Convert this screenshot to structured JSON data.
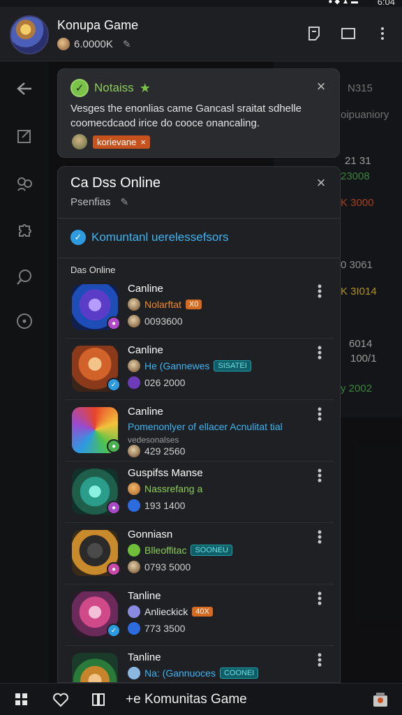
{
  "status": {
    "time": "6:04"
  },
  "header": {
    "title": "Konupa Game",
    "coins": "6.0000K",
    "icons": [
      "note-icon",
      "window-icon",
      "more-icon"
    ]
  },
  "notification": {
    "title": "Notaiss",
    "body": "Vesges the enonlias came Gancasl sraitat sdhelle coomecdcaod irice do cooce onancaling.",
    "chip": "korievаne"
  },
  "background_panel": {
    "lines": [
      {
        "text": "N315",
        "color": "#9a9a9a"
      },
      {
        "text": "oipuaniory",
        "color": "#9a9a9a"
      },
      {
        "text": "21 31",
        "color": "#cfcfcf"
      },
      {
        "text": "23008",
        "color": "#4caf50"
      },
      {
        "text": "K 3000",
        "color": "#e0552a"
      },
      {
        "text": "0 3061",
        "color": "#bdbdbd"
      },
      {
        "text": "K 3I014",
        "color": "#e8c02a"
      },
      {
        "text": "6014",
        "color": "#cfcfcf"
      },
      {
        "text": "100/1",
        "color": "#cfcfcf"
      },
      {
        "text": "y 2002",
        "color": "#4caf50"
      }
    ]
  },
  "modal": {
    "title": "Ca Dss Online",
    "subtitle": "Psenfias",
    "verify_text": "Komuntanl uerelessefsors",
    "section_label": "Das Online",
    "items": [
      {
        "name": "Canline",
        "meta": "Nolarftat",
        "meta_color": "#f08a2a",
        "tag": "X0",
        "tag_style": "orange",
        "count": "0093600",
        "thumb": "purple"
      },
      {
        "name": "Canline",
        "meta": "He (Gannewes",
        "meta_color": "#3fb4f2",
        "tag": "SISATEI",
        "tag_style": "teal",
        "count": "026 2000",
        "thumb": "fire"
      },
      {
        "name": "Canline",
        "meta": "Pomenonlyer of ellacer Acnulitat tial",
        "meta_color": "#3fb4f2",
        "tag": "",
        "tag_style": "",
        "extra": "vedesonalses",
        "count": "429 2560",
        "thumb": "rainbow"
      },
      {
        "name": "Guspifss Manse",
        "meta": "Nassrefang a",
        "meta_color": "#8ccd59",
        "tag": "",
        "tag_style": "",
        "count": "193 1400",
        "thumb": "teal"
      },
      {
        "name": "Gonniasn",
        "meta": "Blleoffitac",
        "meta_color": "#8ccd59",
        "tag": "SOONEU",
        "tag_style": "teal",
        "count": "0793 5000",
        "thumb": "dark"
      },
      {
        "name": "Tanline",
        "meta": "Anlieckick",
        "meta_color": "#e6e6e6",
        "tag": "40X",
        "tag_style": "orange",
        "count": "773 3500",
        "thumb": "pink"
      },
      {
        "name": "Tanline",
        "meta": "Na: (Gannuoces",
        "meta_color": "#3fb4f2",
        "tag": "COONEI",
        "tag_style": "teal",
        "count": "",
        "thumb": "hat"
      }
    ]
  },
  "bottom_bar": {
    "label": "+e Komunitas Game"
  }
}
